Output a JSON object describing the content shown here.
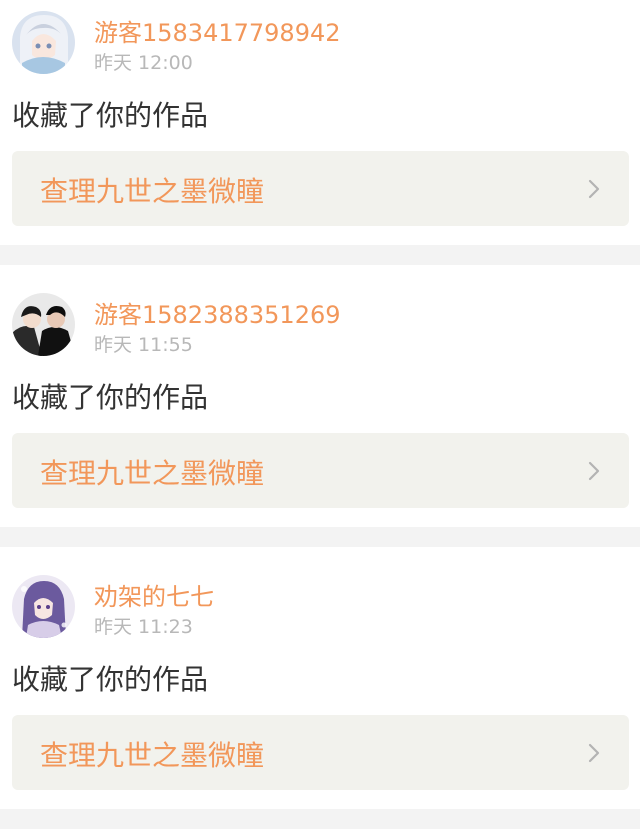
{
  "notifications": [
    {
      "username": "游客1583417798942",
      "time": "昨天 12:00",
      "action": "收藏了你的作品",
      "work_title": "查理九世之墨微瞳",
      "avatar_icon": "anime-girl-white-hair-avatar"
    },
    {
      "username": "游客1582388351269",
      "time": "昨天 11:55",
      "action": "收藏了你的作品",
      "work_title": "查理九世之墨微瞳",
      "avatar_icon": "two-men-costume-avatar"
    },
    {
      "username": "劝架的七七",
      "time": "昨天 11:23",
      "action": "收藏了你的作品",
      "work_title": "查理九世之墨微瞳",
      "avatar_icon": "anime-girl-purple-hair-avatar"
    }
  ],
  "colors": {
    "accent": "#f2975a",
    "time_text": "#b8b8b8",
    "work_box_bg": "#f2f2ed",
    "separator_bg": "#f3f3f3"
  }
}
